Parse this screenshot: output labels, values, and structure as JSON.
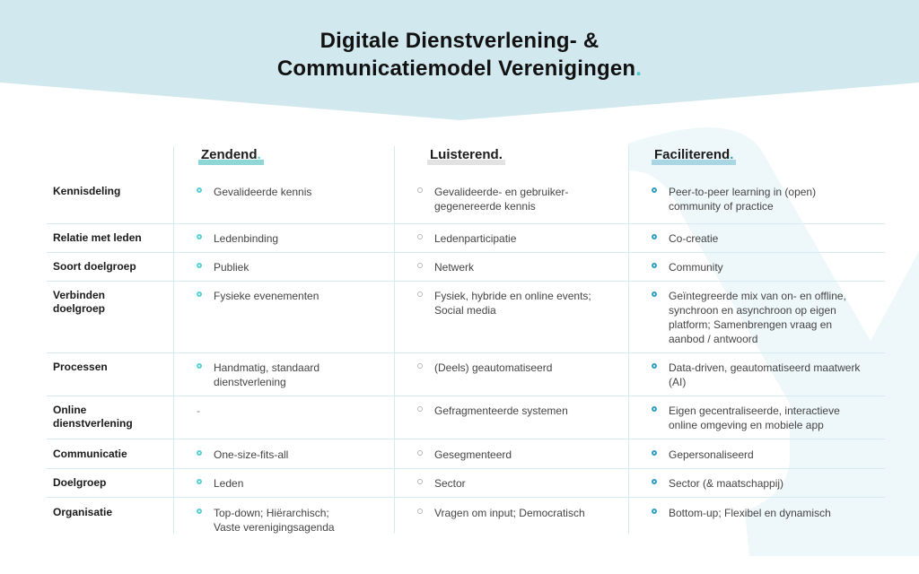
{
  "title": {
    "line1": "Digitale Dienstverlening- &",
    "line2": "Communicatiemodel Verenigingen",
    "dot": "."
  },
  "colors": {
    "banner": "#d1e8ef",
    "accent_zendend": "#58cfd1",
    "accent_luisterend": "#dcdcdc",
    "accent_faciliterend": "#2f9fbd"
  },
  "columns": [
    {
      "label": "Zendend",
      "dot": "."
    },
    {
      "label": "Luisterend",
      "dot": "."
    },
    {
      "label": "Faciliterend",
      "dot": "."
    }
  ],
  "rows": [
    {
      "label": "Kennisdeling",
      "zendend": "Gevalideerde kennis",
      "luisterend": "Gevalideerde- en gebruiker-\ngegenereerde kennis",
      "faciliterend": "Peer-to-peer learning in (open)\ncommunity of practice"
    },
    {
      "label": "Relatie met leden",
      "zendend": "Ledenbinding",
      "luisterend": "Ledenparticipatie",
      "faciliterend": "Co-creatie"
    },
    {
      "label": "Soort doelgroep",
      "zendend": "Publiek",
      "luisterend": "Netwerk",
      "faciliterend": "Community"
    },
    {
      "label": "Verbinden\ndoelgroep",
      "zendend": "Fysieke evenementen",
      "luisterend": "Fysiek, hybride en online events;\nSocial media",
      "faciliterend": "Geïntegreerde mix van on- en offline,\nsynchroon en asynchroon op eigen\nplatform;  Samenbrengen vraag en\naanbod / antwoord"
    },
    {
      "label": "Processen",
      "zendend": "Handmatig, standaard\ndienstverlening",
      "luisterend": "(Deels) geautomatiseerd",
      "faciliterend": "Data-driven, geautomatiseerd maatwerk\n(AI)"
    },
    {
      "label": "Online\ndienstverlening",
      "zendend": "-",
      "luisterend": "Gefragmenteerde systemen",
      "faciliterend": "Eigen gecentraliseerde, interactieve\nonline omgeving en mobiele app"
    },
    {
      "label": "Communicatie",
      "zendend": "One-size-fits-all",
      "luisterend": "Gesegmenteerd",
      "faciliterend": "Gepersonaliseerd"
    },
    {
      "label": "Doelgroep",
      "zendend": "Leden",
      "luisterend": "Sector",
      "faciliterend": "Sector (& maatschappij)"
    },
    {
      "label": "Organisatie",
      "zendend": "Top-down; Hiërarchisch;\n Vaste verenigingsagenda",
      "luisterend": "Vragen om input; Democratisch",
      "faciliterend": "Bottom-up; Flexibel en dynamisch"
    }
  ]
}
